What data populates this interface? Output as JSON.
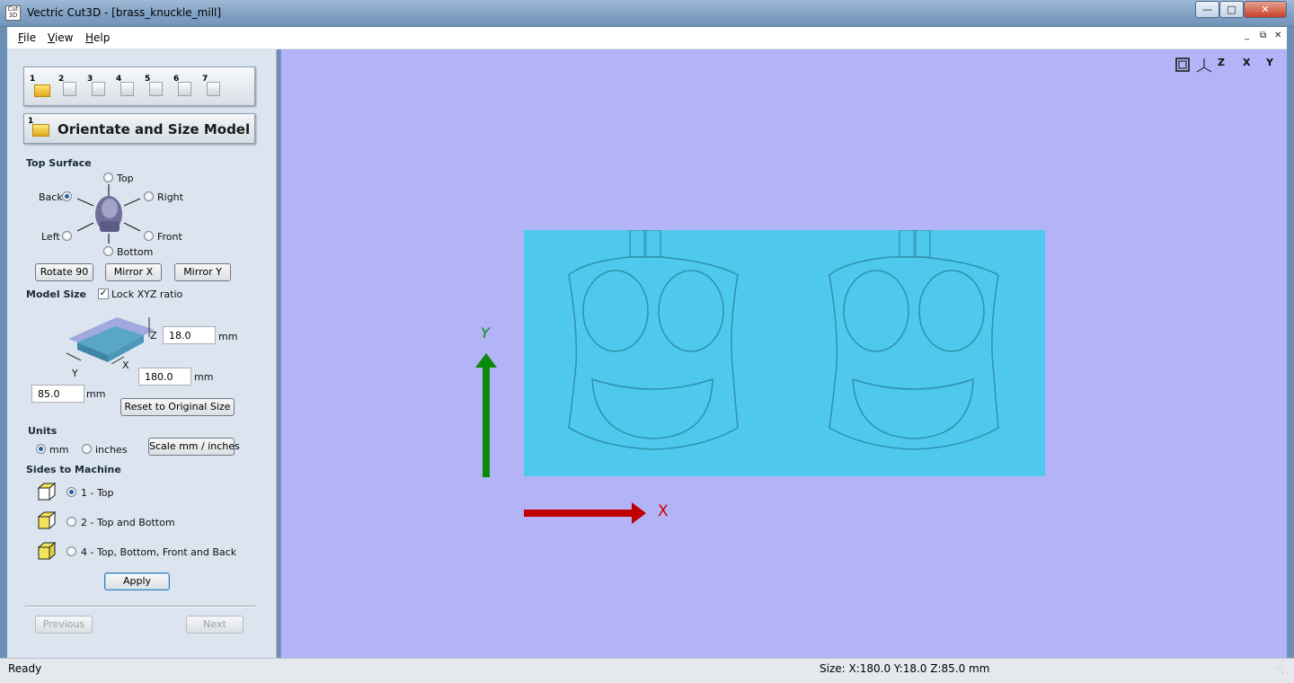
{
  "window": {
    "title": "Vectric Cut3D - [brass_knuckle_mill]",
    "icon_text": "Cut 3D",
    "min_icon": "minimize-icon",
    "max_icon": "maximize-icon",
    "close_icon": "close-icon"
  },
  "menu": {
    "file": "File",
    "view": "View",
    "help": "Help",
    "mdi_min": "_",
    "mdi_restore": "⧉",
    "mdi_close": "✕"
  },
  "steps": [
    "1",
    "2",
    "3",
    "4",
    "5",
    "6",
    "7"
  ],
  "step_header": {
    "number": "1",
    "title": "Orientate and Size Model"
  },
  "top_surface": {
    "label": "Top Surface",
    "top": "Top",
    "back": "Back",
    "right": "Right",
    "left": "Left",
    "front": "Front",
    "bottom": "Bottom",
    "selected": "Back",
    "rotate": "Rotate 90",
    "mirror_x": "Mirror X",
    "mirror_y": "Mirror Y"
  },
  "model_size": {
    "label": "Model Size",
    "lock_label": "Lock XYZ ratio",
    "lock_checked": true,
    "z_value": "18.0",
    "x_value": "180.0",
    "y_value": "85.0",
    "unit": "mm",
    "axis_z": "Z",
    "axis_x": "X",
    "axis_y": "Y",
    "reset": "Reset to Original Size"
  },
  "units": {
    "label": "Units",
    "mm": "mm",
    "inches": "inches",
    "selected": "mm",
    "scale": "Scale mm / inches"
  },
  "sides": {
    "label": "Sides to Machine",
    "option1": "1 - Top",
    "option2": "2 - Top and Bottom",
    "option4": "4 - Top, Bottom, Front and Back",
    "selected": "1 - Top",
    "apply": "Apply"
  },
  "nav": {
    "previous": "Previous",
    "next": "Next"
  },
  "viewport": {
    "background": "#b3b3f7",
    "model_color": "#4ec9ed",
    "x_axis_label": "X",
    "y_axis_label": "Y",
    "x_axis_color": "#cc0000",
    "y_axis_color": "#0a8a0a",
    "view_buttons": [
      "fit-view-icon",
      "iso-view-icon",
      "top-view-icon",
      "front-view-icon",
      "side-view-icon"
    ],
    "view_labels": [
      "",
      "",
      "Z",
      "X",
      "Y"
    ]
  },
  "status": {
    "ready": "Ready",
    "size": "Size: X:180.0 Y:18.0 Z:85.0 mm"
  }
}
